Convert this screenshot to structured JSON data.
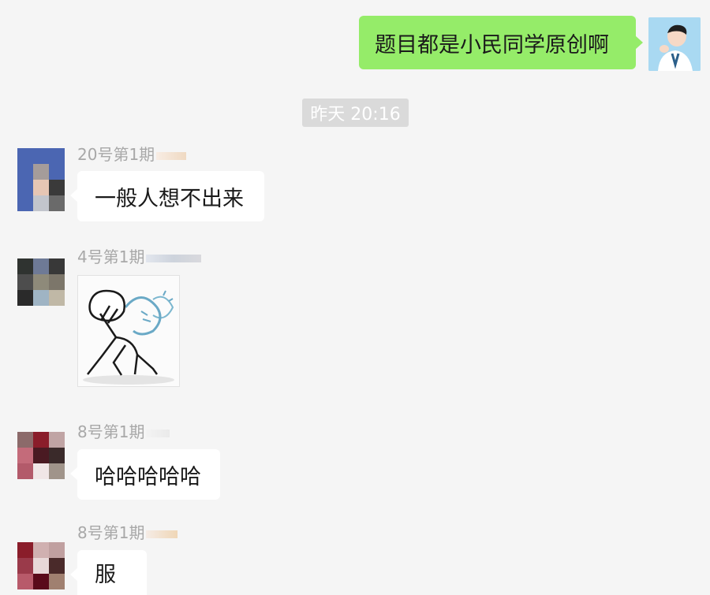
{
  "messages": {
    "self": {
      "text": "题目都是小民同学原创啊",
      "avatar_icon": "person-thinking-avatar"
    },
    "timestamp": "昨天 20:16",
    "incoming": [
      {
        "sender": "20号第1期",
        "text": "一般人想不出来"
      },
      {
        "sender": "4号第1期",
        "sticker_icon": "stick-figure-sticker"
      },
      {
        "sender": "8号第1期",
        "text": "哈哈哈哈哈"
      },
      {
        "sender": "8号第1期",
        "text": "服"
      }
    ]
  },
  "colors": {
    "self_bubble": "#95ec69",
    "incoming_bubble": "#ffffff",
    "background": "#f5f5f5",
    "sender_text": "#a8a8a8",
    "timestamp_bg": "#dadada"
  }
}
